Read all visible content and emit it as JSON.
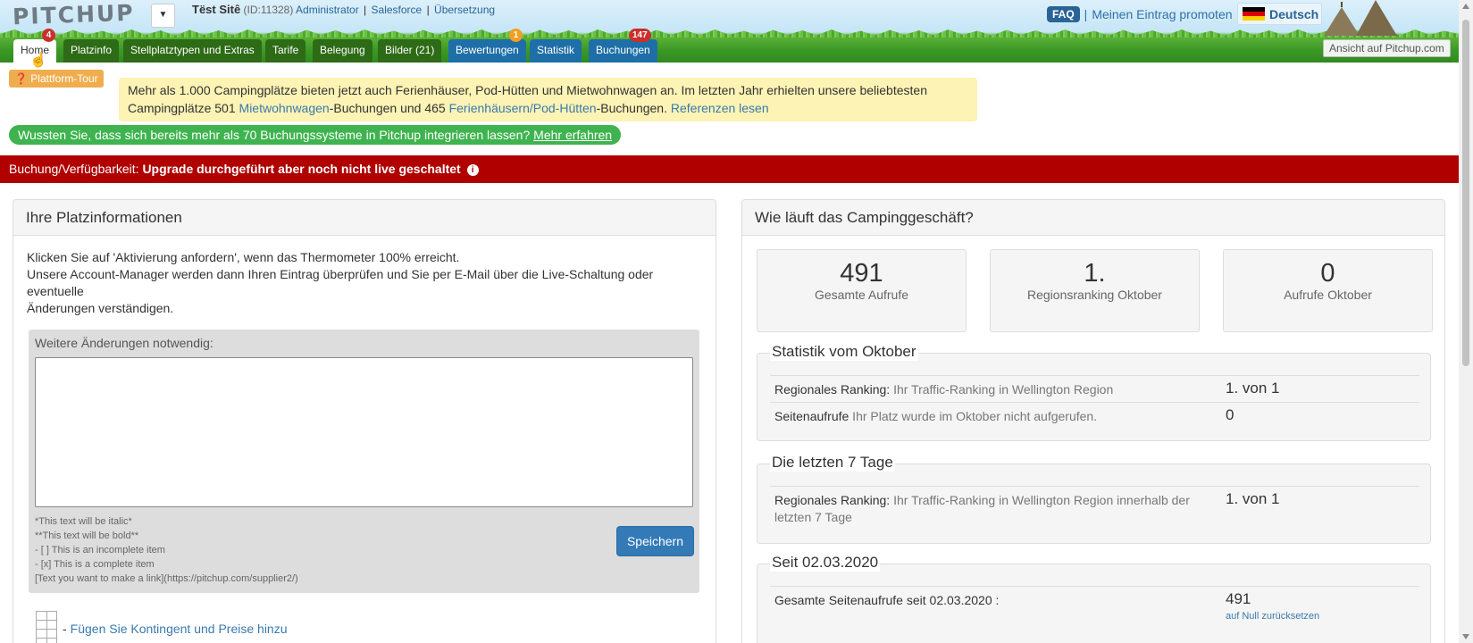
{
  "header": {
    "logo": "PITCHUP",
    "site_name": "Tëst Sitê",
    "site_id": "(ID:11328)",
    "links": [
      "Administrator",
      "Salesforce",
      "Übersetzung"
    ],
    "faq": "FAQ",
    "promote": "Meinen Eintrag promoten",
    "language": "Deutsch",
    "view_on_site": "Ansicht auf Pitchup.com"
  },
  "tabs": [
    {
      "label": "Home",
      "badge": "4"
    },
    {
      "label": "Platzinfo"
    },
    {
      "label": "Stellplatztypen und Extras"
    },
    {
      "label": "Tarife"
    },
    {
      "label": "Belegung"
    },
    {
      "label": "Bilder (21)"
    },
    {
      "label": "Bewertungen",
      "badge": "1"
    },
    {
      "label": "Statistik"
    },
    {
      "label": "Buchungen",
      "badge": "147"
    }
  ],
  "tour_button": "Plattform-Tour",
  "promo": {
    "line1": "Mehr als 1.000 Campingplätze bieten jetzt auch Ferienhäuser, Pod-Hütten und Mietwohnwagen an. Im letzten Jahr erhielten unsere beliebtesten",
    "line2_a": "Campingplätze 501 ",
    "link1": "Mietwohnwagen",
    "line2_b": "-Buchungen und 465 ",
    "link2": "Ferienhäusern/Pod-Hütten",
    "line2_c": "-Buchungen. ",
    "link3": "Referenzen lesen"
  },
  "systems_notice": {
    "text": "Wussten Sie, dass sich bereits mehr als 70 Buchungssysteme in Pitchup integrieren lassen? ",
    "link": "Mehr erfahren"
  },
  "booking_status": {
    "label": "Buchung/Verfügbarkeit: ",
    "value": "Upgrade durchgeführt aber noch nicht live geschaltet"
  },
  "left_panel": {
    "title": "Ihre Platzinformationen",
    "intro1": "Klicken Sie auf 'Aktivierung anfordern', wenn das Thermometer 100% erreicht.",
    "intro2": "Unsere Account-Manager werden dann Ihren Eintrag überprüfen und Sie per E-Mail über die Live-Schaltung oder eventuelle",
    "intro3": "Änderungen verständigen.",
    "changes_label": "Weitere Änderungen notwendig:",
    "changes_value": "",
    "markdown_help": [
      "*This text will be italic*",
      "**This text will be bold**",
      "- [ ] This is an incomplete item",
      "- [x] This is a complete item",
      "[Text you want to make a link](https://pitchup.com/supplier2/)"
    ],
    "save_button": "Speichern",
    "add_link": "Fügen Sie Kontingent und Preise hinzu"
  },
  "right_panel": {
    "title": "Wie läuft das Campinggeschäft?",
    "stats": [
      {
        "value": "491",
        "label": "Gesamte Aufrufe"
      },
      {
        "value": "1.",
        "label": "Regionsranking Oktober"
      },
      {
        "value": "0",
        "label": "Aufrufe Oktober"
      }
    ],
    "october": {
      "legend": "Statistik vom Oktober",
      "rows": [
        {
          "key": "Regionales Ranking:",
          "desc": " Ihr Traffic-Ranking in Wellington Region",
          "value": "1. von 1"
        },
        {
          "key": "Seitenaufrufe",
          "desc": " Ihr Platz wurde im Oktober nicht aufgerufen.",
          "value": "0"
        }
      ]
    },
    "last7": {
      "legend": "Die letzten 7 Tage",
      "rows": [
        {
          "key": "Regionales Ranking:",
          "desc": " Ihr Traffic-Ranking in Wellington Region innerhalb der letzten 7 Tage",
          "value": "1. von 1"
        }
      ]
    },
    "since": {
      "legend": "Seit 02.03.2020",
      "rows": [
        {
          "key": "Gesamte Seitenaufrufe seit 02.03.2020 :",
          "desc": "",
          "value": "491",
          "reset": "auf Null zurücksetzen"
        }
      ]
    }
  },
  "colors": {
    "red_bar": "#b00000",
    "green_pill": "#3fb34f",
    "tab_green": "#2d6b16",
    "tab_blue": "#1e6fa8",
    "save_blue": "#337ab7"
  }
}
